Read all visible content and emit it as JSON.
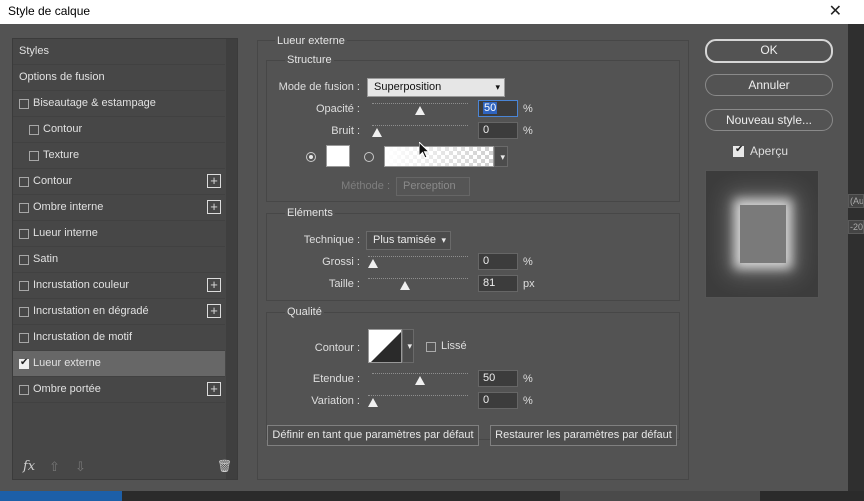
{
  "window": {
    "title": "Style de calque",
    "close_glyph": "✕"
  },
  "left": {
    "items": [
      {
        "label": "Styles",
        "checkbox": false,
        "checked": false,
        "plus": false,
        "indent": false,
        "selected": false
      },
      {
        "label": "Options de fusion",
        "checkbox": false,
        "checked": false,
        "plus": false,
        "indent": false,
        "selected": false
      },
      {
        "label": "Biseautage & estampage",
        "checkbox": true,
        "checked": false,
        "plus": false,
        "indent": false,
        "selected": false
      },
      {
        "label": "Contour",
        "checkbox": true,
        "checked": false,
        "plus": false,
        "indent": true,
        "selected": false
      },
      {
        "label": "Texture",
        "checkbox": true,
        "checked": false,
        "plus": false,
        "indent": true,
        "selected": false
      },
      {
        "label": "Contour",
        "checkbox": true,
        "checked": false,
        "plus": true,
        "indent": false,
        "selected": false
      },
      {
        "label": "Ombre interne",
        "checkbox": true,
        "checked": false,
        "plus": true,
        "indent": false,
        "selected": false
      },
      {
        "label": "Lueur interne",
        "checkbox": true,
        "checked": false,
        "plus": false,
        "indent": false,
        "selected": false
      },
      {
        "label": "Satin",
        "checkbox": true,
        "checked": false,
        "plus": false,
        "indent": false,
        "selected": false
      },
      {
        "label": "Incrustation couleur",
        "checkbox": true,
        "checked": false,
        "plus": true,
        "indent": false,
        "selected": false
      },
      {
        "label": "Incrustation en dégradé",
        "checkbox": true,
        "checked": false,
        "plus": true,
        "indent": false,
        "selected": false
      },
      {
        "label": "Incrustation de motif",
        "checkbox": true,
        "checked": false,
        "plus": false,
        "indent": false,
        "selected": false
      },
      {
        "label": "Lueur externe",
        "checkbox": true,
        "checked": true,
        "plus": false,
        "indent": false,
        "selected": true
      },
      {
        "label": "Ombre portée",
        "checkbox": true,
        "checked": false,
        "plus": true,
        "indent": false,
        "selected": false
      }
    ],
    "footer": {
      "fx": "fx",
      "up": "⇧",
      "down": "⇩",
      "trash": "🗑"
    }
  },
  "main": {
    "section_title": "Lueur externe",
    "structure": {
      "title": "Structure",
      "mode_label": "Mode de fusion :",
      "mode_value": "Superposition",
      "opacity_label": "Opacité :",
      "opacity_value": "50",
      "opacity_fraction": 0.5,
      "noise_label": "Bruit :",
      "noise_value": "0",
      "noise_fraction": 0.0,
      "unit_percent": "%",
      "method_label": "Méthode :",
      "method_value": "Perception"
    },
    "elements": {
      "title": "Eléments",
      "technique_label": "Technique :",
      "technique_value": "Plus tamisée",
      "spread_label": "Grossi :",
      "spread_value": "0",
      "spread_fraction": 0.0,
      "size_label": "Taille :",
      "size_value": "81",
      "size_fraction": 0.35,
      "unit_percent": "%",
      "unit_px": "px"
    },
    "quality": {
      "title": "Qualité",
      "contour_label": "Contour :",
      "smooth_label": "Lissé",
      "range_label": "Etendue :",
      "range_value": "50",
      "range_fraction": 0.5,
      "jitter_label": "Variation :",
      "jitter_value": "0",
      "jitter_fraction": 0.0,
      "unit_percent": "%"
    },
    "buttons": {
      "set_default": "Définir en tant que paramètres par défaut",
      "reset_default": "Restaurer les paramètres par défaut"
    }
  },
  "side": {
    "ok": "OK",
    "cancel": "Annuler",
    "new_style": "Nouveau style...",
    "preview_label": "Aperçu",
    "preview_checked": true
  },
  "background_strip": [
    "(Au",
    "-20"
  ]
}
